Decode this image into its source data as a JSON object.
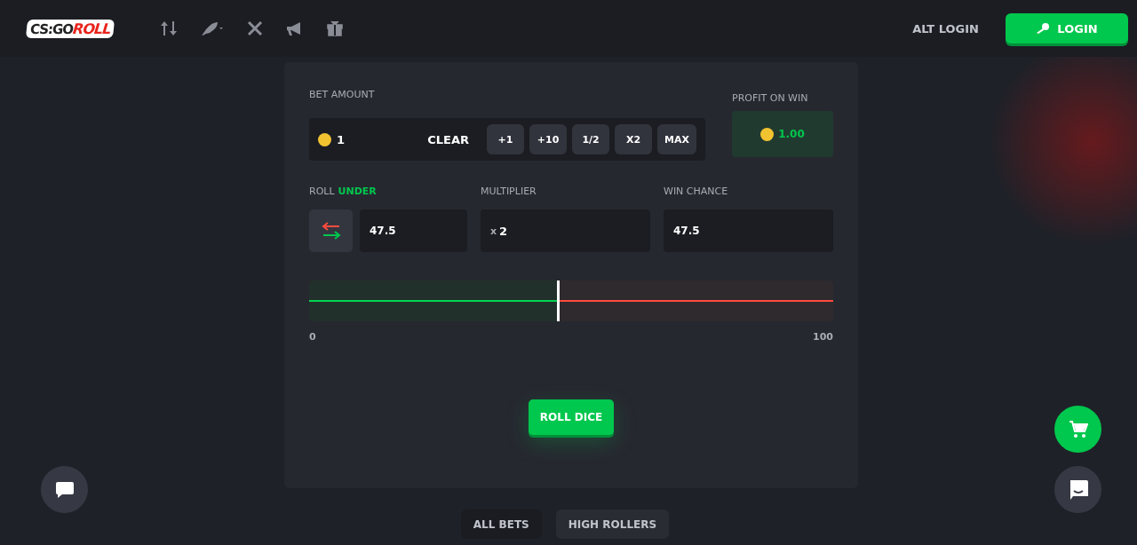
{
  "header": {
    "logo": {
      "left": "CS:GO",
      "right": "ROLL"
    },
    "alt_login": "ALT LOGIN",
    "login": "LOGIN"
  },
  "bet": {
    "label": "BET AMOUNT",
    "value": "1",
    "clear": "CLEAR",
    "buttons": [
      "+1",
      "+10",
      "1/2",
      "X2",
      "MAX"
    ]
  },
  "profit": {
    "label": "PROFIT ON WIN",
    "value": "1.00"
  },
  "roll": {
    "label": "ROLL",
    "direction": "UNDER",
    "value": "47.5"
  },
  "multiplier": {
    "label": "MULTIPLIER",
    "prefix": "x",
    "value": "2"
  },
  "win_chance": {
    "label": "WIN CHANCE",
    "value": "47.5"
  },
  "slider": {
    "level": 0.475,
    "min": "0",
    "max": "100"
  },
  "roll_button": "ROLL DICE",
  "tabs": [
    {
      "label": "ALL BETS",
      "selected": true
    },
    {
      "label": "HIGH ROLLERS",
      "selected": false
    }
  ]
}
